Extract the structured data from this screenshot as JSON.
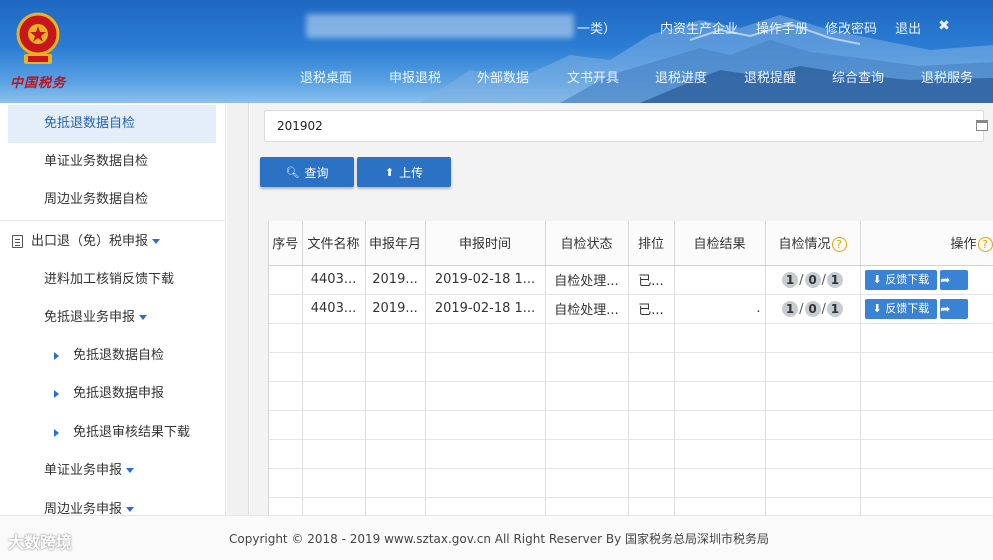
{
  "header": {
    "logo_text": "中国税务",
    "user_info": "一类）",
    "top_links": {
      "enterprise_type": "内资生产企业",
      "manual": "操作手册",
      "change_password": "修改密码",
      "logout": "退出",
      "fullscreen_icon": "✖"
    },
    "nav": [
      "退税桌面",
      "申报退税",
      "外部数据",
      "文书开具",
      "退税进度",
      "退税提醒",
      "综合查询",
      "退税服务"
    ]
  },
  "sidebar": {
    "items": [
      {
        "label": "免抵退数据自检",
        "active": true
      },
      {
        "label": "单证业务数据自检"
      },
      {
        "label": "周边业务数据自检"
      },
      {
        "label": "出口退（免）税申报",
        "icon": "document-icon"
      },
      {
        "label": "进料加工核销反馈下载"
      },
      {
        "label": "免抵退业务申报"
      },
      {
        "label": "免抵退数据自检"
      },
      {
        "label": "免抵退数据申报"
      },
      {
        "label": "免抵退审核结果下载"
      },
      {
        "label": "单证业务申报"
      },
      {
        "label": "周边业务申报"
      }
    ]
  },
  "filter": {
    "period_value": "201902"
  },
  "buttons": {
    "query": "查询",
    "upload": "上传"
  },
  "table": {
    "headers": {
      "seq": "序号",
      "file_name": "文件名称",
      "period": "申报年月",
      "time": "申报时间",
      "status": "自检状态",
      "rank": "排位",
      "result": "自检结果",
      "detail": "自检情况",
      "action": "操作"
    },
    "rows": [
      {
        "seq": "",
        "file_name": "4403...",
        "period": "2019...",
        "time": "2019-02-18 1...",
        "status": "自检处理...",
        "rank": "已...",
        "result": "",
        "a": "1",
        "b": "0",
        "c": "1",
        "action_label": "反馈下载"
      },
      {
        "seq": "",
        "file_name": "4403...",
        "period": "2019...",
        "time": "2019-02-18 1...",
        "status": "自检处理...",
        "rank": "已...",
        "result": ".",
        "a": "1",
        "b": "0",
        "c": "1",
        "action_label": "反馈下载"
      }
    ]
  },
  "footer": {
    "copyright": "Copyright © 2018 - 2019 www.sztax.gov.cn All Right Reserver By 国家税务总局深圳市税务局",
    "watermark": "大数跨境"
  },
  "colors": {
    "header_blue": "#2a7cd3",
    "button_blue": "#2b72c4",
    "active_item_bg": "#e4eef9",
    "help_icon": "#e0a800"
  }
}
